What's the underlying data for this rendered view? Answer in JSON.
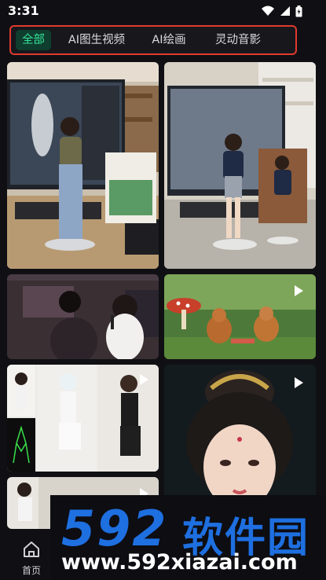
{
  "status_bar": {
    "time": "3:31"
  },
  "tabs": [
    {
      "label": "全部",
      "active": true
    },
    {
      "label": "AI图生视频",
      "active": false
    },
    {
      "label": "AI绘画",
      "active": false
    },
    {
      "label": "灵动音影",
      "active": false
    }
  ],
  "nav": {
    "home_label": "首页"
  },
  "watermark": {
    "brand": "592",
    "brand_suffix": "软件园",
    "url": "www.592xiazai.com"
  },
  "colors": {
    "accent_green": "#35e39a",
    "highlight_red": "#e03a2f",
    "watermark_blue": "#1e6fe0"
  }
}
